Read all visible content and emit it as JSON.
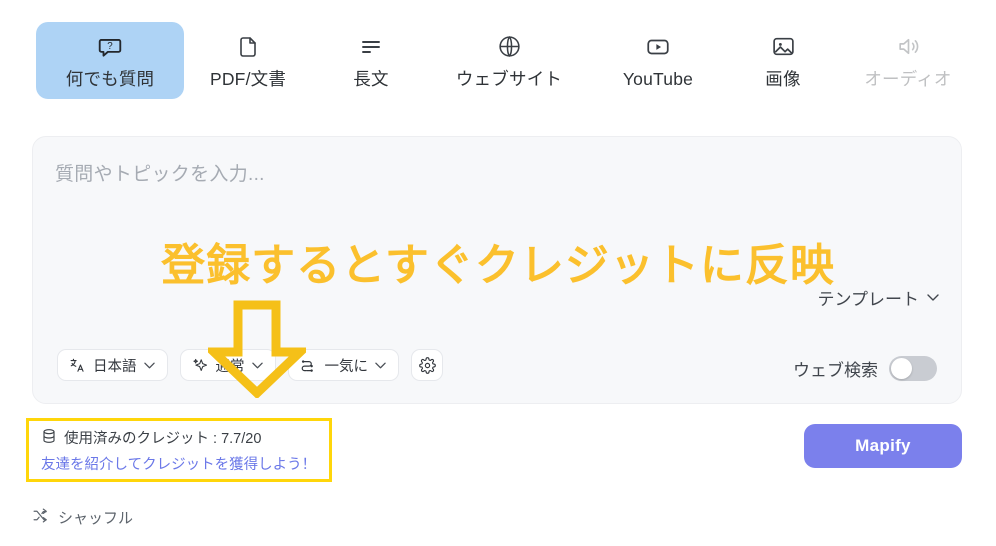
{
  "tabs": [
    {
      "label": "何でも質問",
      "icon": "question-bubble-icon",
      "active": true,
      "faded": false,
      "width_class": ""
    },
    {
      "label": "PDF/文書",
      "icon": "document-icon",
      "active": false,
      "faded": false,
      "width_class": "tab-w-pdf"
    },
    {
      "label": "長文",
      "icon": "text-lines-icon",
      "active": false,
      "faded": false,
      "width_class": "tab-w-long"
    },
    {
      "label": "ウェブサイト",
      "icon": "globe-icon",
      "active": false,
      "faded": false,
      "width_class": "tab-w-site"
    },
    {
      "label": "YouTube",
      "icon": "youtube-icon",
      "active": false,
      "faded": false,
      "width_class": "tab-w-yt"
    },
    {
      "label": "画像",
      "icon": "image-icon",
      "active": false,
      "faded": false,
      "width_class": "tab-w-img"
    },
    {
      "label": "オーディオ",
      "icon": "speaker-icon",
      "active": false,
      "faded": true,
      "width_class": "tab-w-audio"
    }
  ],
  "input": {
    "placeholder": "質問やトピックを入力...",
    "value": ""
  },
  "promo": {
    "headline": "登録するとすぐクレジットに反映",
    "headline_color": "#fbc02d"
  },
  "template_button": {
    "label": "テンプレート",
    "chevron": "chevron-down-icon"
  },
  "toolbar": {
    "language_chip": {
      "label": "日本語",
      "icon": "translate-icon"
    },
    "mode_chip": {
      "label": "通常",
      "icon": "sparkle-icon"
    },
    "flow_chip": {
      "label": "一気に",
      "icon": "flow-nodes-icon"
    },
    "settings_chip": {
      "icon": "gear-icon"
    }
  },
  "web_search": {
    "label": "ウェブ検索",
    "enabled": false
  },
  "credits": {
    "icon": "database-icon",
    "text": "使用済みのクレジット : 7.7/20",
    "used": "7.7",
    "total": "20",
    "referral_link": "友達を紹介してクレジットを獲得しよう！",
    "highlight_color": "#ffd60a",
    "link_color": "#6b78e8"
  },
  "submit_button": {
    "label": "Mapify",
    "color": "#7b80ec"
  },
  "shuffle": {
    "label": "シャッフル",
    "icon": "shuffle-icon"
  },
  "annotation": {
    "arrow": "down-arrow-annotation",
    "color": "#f5c018"
  }
}
